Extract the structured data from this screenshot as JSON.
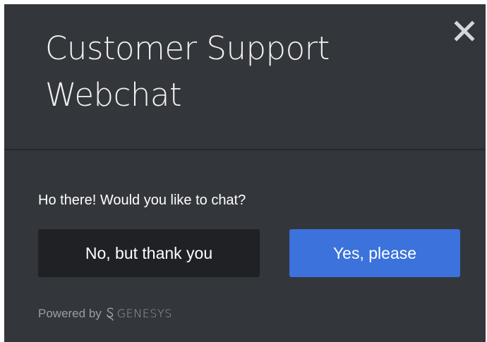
{
  "header": {
    "title": "Customer Support Webchat",
    "close_icon": "close-icon"
  },
  "body": {
    "prompt": "Ho there! Would you like to chat?",
    "decline_label": "No, but thank you",
    "accept_label": "Yes, please"
  },
  "footer": {
    "powered_by": "Powered by",
    "brand": "GENESYS",
    "brand_icon": "genesys-logo-icon"
  },
  "colors": {
    "panel_background": "#33363b",
    "divider": "#26282c",
    "decline_button": "#1f2125",
    "accept_button": "#3b72dc",
    "title_text": "#f1f1f1",
    "footer_text": "#9a9ea5"
  }
}
